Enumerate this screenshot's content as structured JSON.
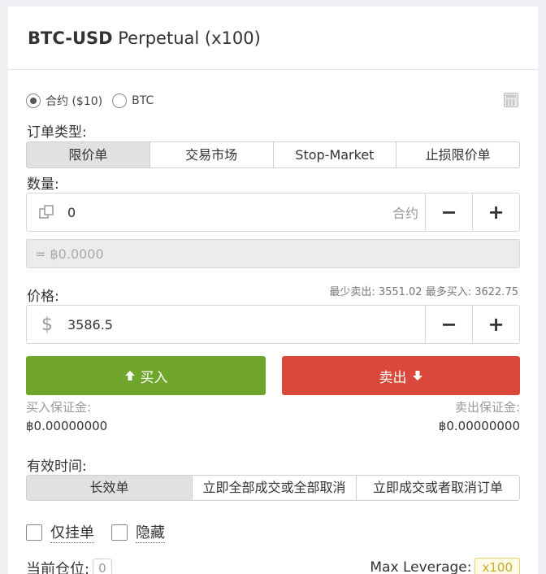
{
  "header": {
    "title_bold": "BTC-USD",
    "title_rest": "Perpetual (x100)"
  },
  "unit_radio": {
    "options": [
      {
        "label": "合约 ($10)",
        "selected": true
      },
      {
        "label": "BTC",
        "selected": false
      }
    ]
  },
  "order_type": {
    "label": "订单类型:",
    "options": [
      "限价单",
      "交易市场",
      "Stop-Market",
      "止损限价单"
    ],
    "active_index": 0
  },
  "quantity": {
    "label": "数量:",
    "value": "0",
    "unit": "合约",
    "decrement": "−",
    "increment": "+",
    "converted": "= ฿0.0000"
  },
  "price": {
    "label": "价格:",
    "min_max": "最少卖出: 3551.02 最多买入: 3622.75",
    "currency_symbol": "$",
    "value": "3586.5",
    "decrement": "−",
    "increment": "+"
  },
  "actions": {
    "buy_label": "买入",
    "sell_label": "卖出",
    "buy_color": "#6ea52a",
    "sell_color": "#d9483b"
  },
  "margins": {
    "buy_label": "买入保证金:",
    "buy_value": "฿0.00000000",
    "sell_label": "卖出保证金:",
    "sell_value": "฿0.00000000"
  },
  "time_in_force": {
    "label": "有效时间:",
    "options": [
      "长效单",
      "立即全部成交或全部取消",
      "立即成交或者取消订单"
    ],
    "active_index": 0
  },
  "flags": {
    "post_only": "仅挂单",
    "hidden": "隐藏"
  },
  "position": {
    "label": "当前仓位:",
    "value": "0"
  },
  "leverage": {
    "label": "Max Leverage:",
    "value": "x100"
  }
}
